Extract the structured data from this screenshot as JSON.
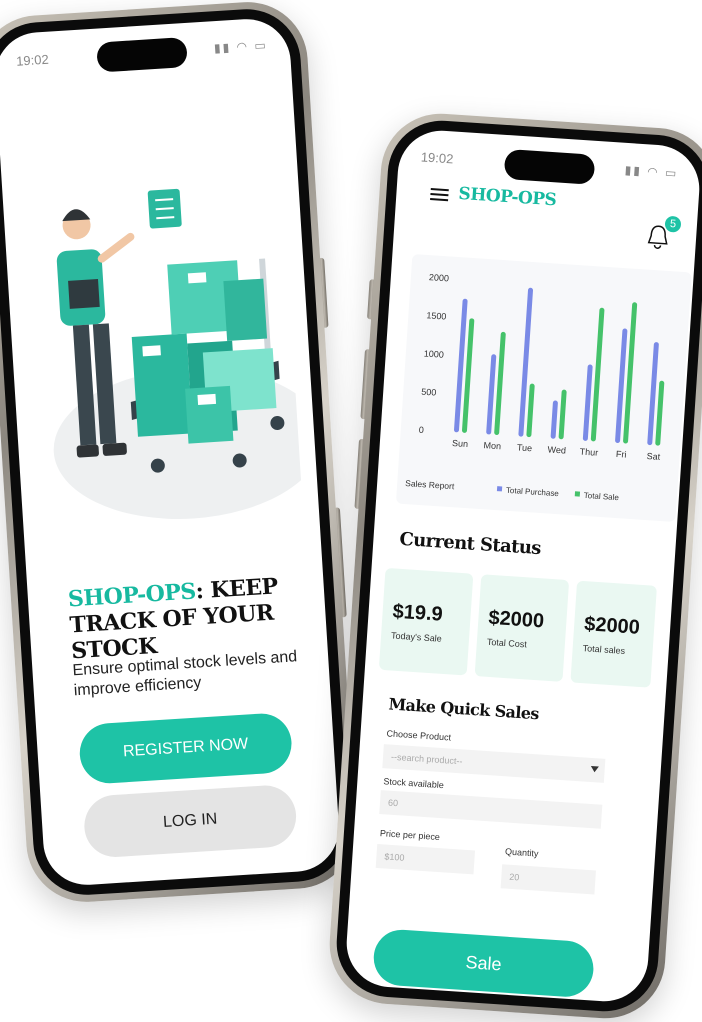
{
  "status_bar": {
    "phone1_time": "19:02",
    "phone2_time": "19:02"
  },
  "welcome": {
    "brand": "SHOP-OPS",
    "headline_rest": ": KEEP TRACK OF YOUR STOCK",
    "tagline": "Ensure optimal stock levels and improve efficiency",
    "register_label": "REGISTER NOW",
    "login_label": "LOG IN"
  },
  "dashboard": {
    "app_title": "SHOP-OPS",
    "notification_count": "5",
    "current_status_title": "Current Status",
    "cards": [
      {
        "value": "$19.9",
        "label": "Today's Sale"
      },
      {
        "value": "$2000",
        "label": "Total Cost"
      },
      {
        "value": "$2000",
        "label": "Total sales"
      }
    ],
    "quick_sales": {
      "title": "Make Quick Sales",
      "choose_product_label": "Choose Product",
      "product_placeholder": "--search product--",
      "stock_label": "Stock available",
      "stock_value": "60",
      "price_label": "Price per piece",
      "price_value": "$100",
      "quantity_label": "Quantity",
      "quantity_value": "20",
      "sale_button": "Sale"
    }
  },
  "colors": {
    "accent": "#1ec3a6",
    "purchase": "#7a8ae6",
    "sale": "#45c26a"
  },
  "chart_data": {
    "type": "bar",
    "title": "Sales Report",
    "categories": [
      "Sun",
      "Mon",
      "Tue",
      "Wed",
      "Thur",
      "Fri",
      "Sat"
    ],
    "ylim": [
      0,
      2000
    ],
    "yticks": [
      "2000",
      "1500",
      "1000",
      "500",
      "0"
    ],
    "series": [
      {
        "name": "Total Purchase",
        "color": "#7a8ae6",
        "values": [
          1750,
          1050,
          1950,
          500,
          1000,
          1500,
          1350
        ]
      },
      {
        "name": "Total Sale",
        "color": "#45c26a",
        "values": [
          1500,
          1350,
          700,
          650,
          1750,
          1850,
          850
        ]
      }
    ],
    "legend": "bottom-right",
    "grid": false
  }
}
